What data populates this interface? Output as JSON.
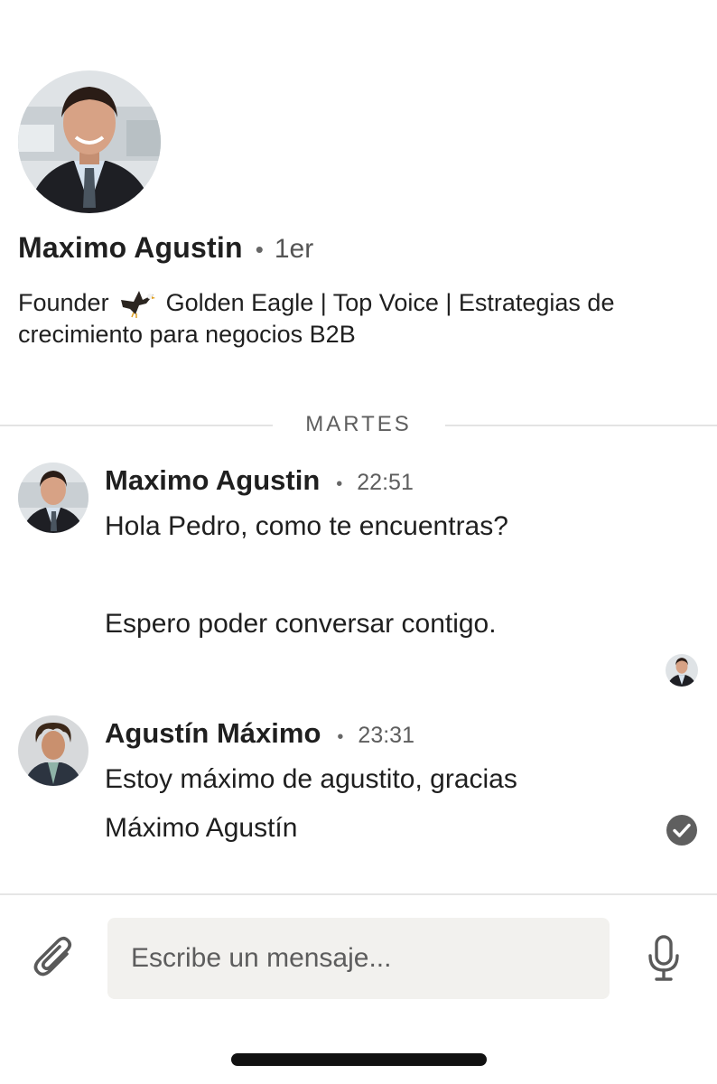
{
  "profile": {
    "name": "Maximo Agustin",
    "separator": "•",
    "degree": "1er",
    "headline_prefix": "Founder",
    "headline_rest": "Golden Eagle | Top Voice | Estrategias de crecimiento para negocios B2B",
    "headline_icon": "eagle-icon"
  },
  "divider": {
    "label": "MARTES"
  },
  "messages": [
    {
      "sender": "Maximo Agustin",
      "separator": "•",
      "time": "22:51",
      "lines": [
        "Hola Pedro, como te encuentras?",
        "Espero poder conversar contigo."
      ]
    },
    {
      "sender": "Agustín Máximo",
      "separator": "•",
      "time": "23:31",
      "lines": [
        "Estoy máximo de agustito, gracias",
        "Máximo Agustín"
      ]
    }
  ],
  "composer": {
    "placeholder": "Escribe un mensaje..."
  },
  "icons": {
    "attach": "paperclip-icon",
    "mic": "microphone-icon",
    "sent_status": "check-circle-icon"
  },
  "colors": {
    "text": "#1f1f1f",
    "muted": "#5e5e5e",
    "composer_bg": "#f2f1ee",
    "divider": "#e3e3e3"
  }
}
